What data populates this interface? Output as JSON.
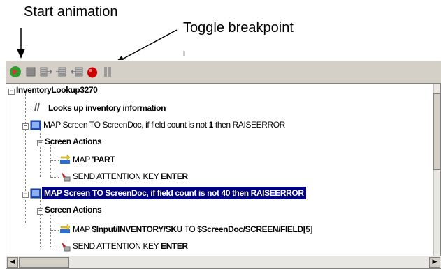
{
  "callouts": {
    "start_animation": "Start animation",
    "toggle_breakpoint": "Toggle breakpoint"
  },
  "toolbar": {
    "buttons": [
      {
        "name": "start-animation-button",
        "icon": "start-animation-icon"
      },
      {
        "name": "stop-button",
        "icon": "stop-icon"
      },
      {
        "name": "step-into-button",
        "icon": "step-into-icon"
      },
      {
        "name": "step-over-button",
        "icon": "step-over-icon"
      },
      {
        "name": "step-out-button",
        "icon": "step-out-icon"
      },
      {
        "name": "toggle-breakpoint-button",
        "icon": "breakpoint-icon"
      },
      {
        "name": "pause-button",
        "icon": "pause-icon"
      }
    ]
  },
  "tree": {
    "root": "InventoryLookup3270",
    "comment": "Looks up inventory information",
    "map1": {
      "prefix": "MAP Screen TO ScreenDoc, if field count is not ",
      "count": "1",
      "suffix": " then RAISEERROR"
    },
    "screen_actions_1": "Screen Actions",
    "map_part": {
      "prefix": "MAP ",
      "value": "'PART"
    },
    "send1": {
      "prefix": "SEND ATTENTION KEY ",
      "key": "ENTER"
    },
    "map2": "MAP Screen TO ScreenDoc, if field count is not 40 then RAISEERROR",
    "screen_actions_2": "Screen Actions",
    "map_input": {
      "prefix": "MAP ",
      "source": "$Input/INVENTORY/SKU",
      "middle": " TO ",
      "target": "$ScreenDoc/SCREEN/FIELD[5]"
    },
    "send2": {
      "prefix": "SEND ATTENTION KEY ",
      "key": "ENTER"
    }
  },
  "colors": {
    "toolbar_bg": "#d4d0c8",
    "selection_bg": "#000080",
    "breakpoint_red": "#cc0000",
    "start_green": "#2e9e2e"
  }
}
